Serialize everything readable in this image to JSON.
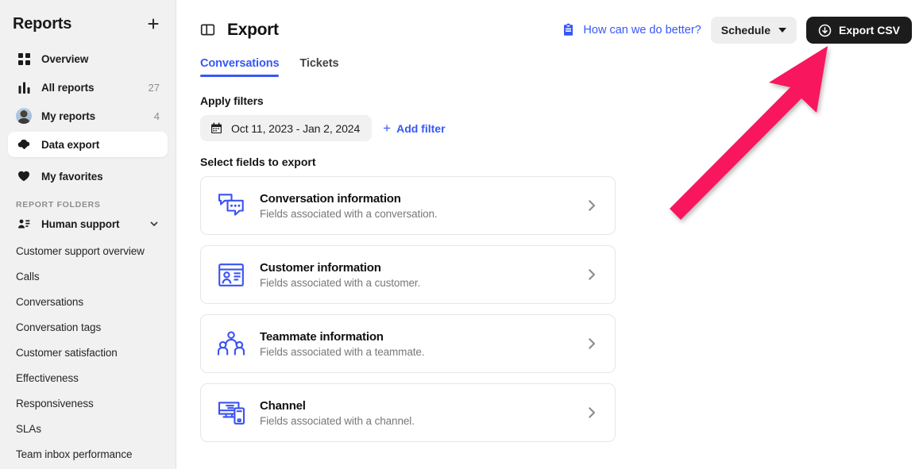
{
  "sidebar": {
    "title": "Reports",
    "add_button": "+",
    "nav": [
      {
        "label": "Overview",
        "icon": "grid-icon",
        "count": ""
      },
      {
        "label": "All reports",
        "icon": "bar-chart-icon",
        "count": "27"
      },
      {
        "label": "My reports",
        "icon": "avatar",
        "count": "4"
      },
      {
        "label": "Data export",
        "icon": "download-cloud-icon",
        "count": ""
      },
      {
        "label": "My favorites",
        "icon": "heart-icon",
        "count": ""
      }
    ],
    "section_label": "REPORT FOLDERS",
    "folder": {
      "label": "Human support",
      "icon": "user-card-icon",
      "chevron": "chevron-down-icon"
    },
    "folder_items": [
      "Customer support overview",
      "Calls",
      "Conversations",
      "Conversation tags",
      "Customer satisfaction",
      "Effectiveness",
      "Responsiveness",
      "SLAs",
      "Team inbox performance"
    ]
  },
  "header": {
    "panel_icon": "sidebar-toggle-icon",
    "title": "Export",
    "feedback_icon": "clipboard-icon",
    "feedback_label": "How can we do better?",
    "schedule_label": "Schedule",
    "schedule_caret": "chevron-down-icon",
    "export_icon": "download-circle-icon",
    "export_label": "Export CSV"
  },
  "tabs": [
    {
      "label": "Conversations",
      "active": true
    },
    {
      "label": "Tickets",
      "active": false
    }
  ],
  "filters": {
    "heading": "Apply filters",
    "date_icon": "calendar-icon",
    "date_range": "Oct 11, 2023 - Jan 2, 2024",
    "add_filter_plus": "+",
    "add_filter_label": "Add filter"
  },
  "fields": {
    "heading": "Select fields to export",
    "cards": [
      {
        "title": "Conversation information",
        "subtitle": "Fields associated with a conversation.",
        "icon": "chat-bubbles-icon"
      },
      {
        "title": "Customer information",
        "subtitle": "Fields associated with a customer.",
        "icon": "id-card-icon"
      },
      {
        "title": "Teammate information",
        "subtitle": "Fields associated with a teammate.",
        "icon": "people-group-icon"
      },
      {
        "title": "Channel",
        "subtitle": "Fields associated with a channel.",
        "icon": "monitor-phone-icon"
      }
    ],
    "chevron": "chevron-right-icon"
  },
  "annotation": {
    "type": "arrow",
    "color": "#f8185f",
    "points_to": "Export CSV"
  },
  "colors": {
    "accent_blue": "#3757f7",
    "icon_blue": "#3a53f0",
    "sidebar_bg": "#f1f1f1",
    "dark_button": "#1c1c1c",
    "annotation_pink": "#f8185f"
  }
}
